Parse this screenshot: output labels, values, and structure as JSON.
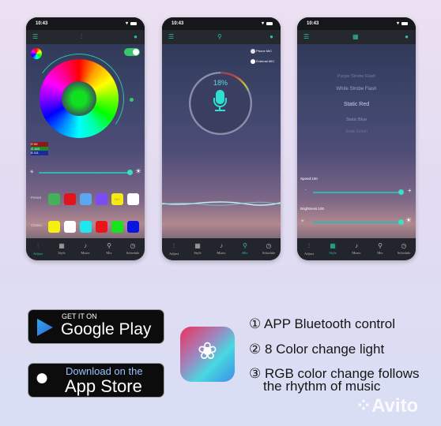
{
  "status_time": "10:43",
  "tabs": [
    "Adjust",
    "Style",
    "Music",
    "Mic",
    "Schedule"
  ],
  "adjust": {
    "rgb": {
      "r_label": "R",
      "r": "59",
      "g_label": "G",
      "g": "163",
      "b_label": "B",
      "b": "111"
    },
    "brightness": 1.0,
    "preset_label": "Preset",
    "preset_colors": [
      "#43b05a",
      "#e0141c",
      "#5aa9f0",
      "#7b4cf2",
      "#f5ea14",
      "#ffffff"
    ],
    "diy_label": "DIY",
    "classic_label": "Classic",
    "classic_colors": [
      "#f7ef10",
      "#ffffff",
      "#22e6ee",
      "#e8151b",
      "#16e51a",
      "#0a16e0"
    ],
    "power_on": true
  },
  "mic": {
    "options": [
      "Phone MIC",
      "External MIC"
    ],
    "level_label": "18%",
    "level": 0.18
  },
  "style": {
    "modes": [
      "Purple Strobe Flash",
      "White Strobe Flash",
      "Static Red",
      "Static Blue",
      "Static Green"
    ],
    "selected": "Static Red",
    "speed_label": "Speed:100",
    "speed": 1.0,
    "brightness_label": "Brightness:100",
    "brightness": 1.0
  },
  "stores": {
    "google_small": "GET IT ON",
    "google_big": "Google Play",
    "apple_small": "Download on the",
    "apple_big": "App Store"
  },
  "features": [
    "① APP Bluetooth control",
    "② 8 Color change light",
    "③ RGB color change follows",
    "the rhythm of music"
  ],
  "watermark": "Avito",
  "colors": {
    "accent": "#2ec4a0"
  }
}
